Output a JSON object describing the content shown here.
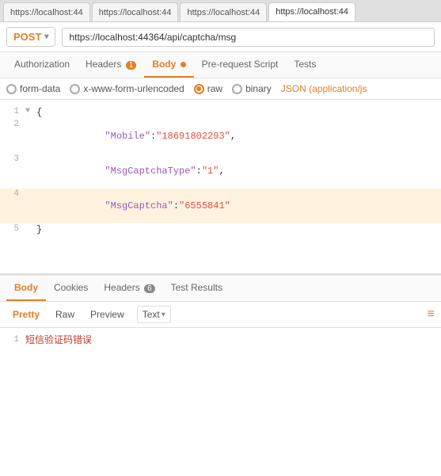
{
  "tabs": [
    {
      "label": "https://localhost:44",
      "active": false
    },
    {
      "label": "https://localhost:44",
      "active": false
    },
    {
      "label": "https://localhost:44",
      "active": false
    },
    {
      "label": "https://localhost:44",
      "active": true
    }
  ],
  "url_bar": {
    "method": "POST",
    "chevron": "▾",
    "url": "https://localhost:44364/api/captcha/msg"
  },
  "request_tabs": [
    {
      "label": "Authorization",
      "active": false,
      "badge": null,
      "dot": false
    },
    {
      "label": "Headers",
      "active": false,
      "badge": "1",
      "dot": false
    },
    {
      "label": "Body",
      "active": true,
      "badge": null,
      "dot": true
    },
    {
      "label": "Pre-request Script",
      "active": false,
      "badge": null,
      "dot": false
    },
    {
      "label": "Tests",
      "active": false,
      "badge": null,
      "dot": false
    }
  ],
  "body_options": [
    {
      "label": "form-data",
      "selected": false
    },
    {
      "label": "x-www-form-urlencoded",
      "selected": false
    },
    {
      "label": "raw",
      "selected": true
    },
    {
      "label": "binary",
      "selected": false
    }
  ],
  "json_label": "JSON (application/js",
  "code_lines": [
    {
      "num": "1",
      "toggle": "▼",
      "content": "{",
      "type": "brace",
      "highlighted": false
    },
    {
      "num": "2",
      "toggle": "",
      "content": "    \"Mobile\":\"18691802293\",",
      "type": "key_string",
      "highlighted": false
    },
    {
      "num": "3",
      "toggle": "",
      "content": "    \"MsgCaptchaType\":\"1\",",
      "type": "key_string",
      "highlighted": false
    },
    {
      "num": "4",
      "toggle": "",
      "content": "    \"MsgCaptcha\":\"6555841\"",
      "type": "key_string",
      "highlighted": true
    },
    {
      "num": "5",
      "toggle": "",
      "content": "}",
      "type": "brace",
      "highlighted": false
    }
  ],
  "response_tabs": [
    {
      "label": "Body",
      "active": true
    },
    {
      "label": "Cookies",
      "active": false
    },
    {
      "label": "Headers",
      "active": false,
      "badge": "6"
    },
    {
      "label": "Test Results",
      "active": false
    }
  ],
  "format_buttons": [
    {
      "label": "Pretty",
      "active": true
    },
    {
      "label": "Raw",
      "active": false
    },
    {
      "label": "Preview",
      "active": false
    }
  ],
  "text_select": {
    "label": "Text",
    "chevron": "▾"
  },
  "wrap_icon": "≡",
  "response_lines": [
    {
      "num": "1",
      "content": "短信验证码错误"
    }
  ]
}
